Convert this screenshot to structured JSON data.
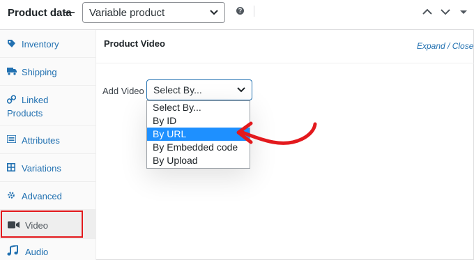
{
  "header": {
    "title": "Product data",
    "dash": "—",
    "product_type": "Variable product"
  },
  "sidebar": {
    "items": [
      {
        "label": "Inventory",
        "icon": "tag-icon"
      },
      {
        "label": "Shipping",
        "icon": "truck-icon"
      },
      {
        "label": "Linked",
        "label2": "Products",
        "icon": "link-icon"
      },
      {
        "label": "Attributes",
        "icon": "list-icon"
      },
      {
        "label": "Variations",
        "icon": "grid-icon"
      },
      {
        "label": "Advanced",
        "icon": "gear-icon"
      },
      {
        "label": "Video",
        "icon": "video-camera-icon"
      },
      {
        "label": "Audio",
        "icon": "music-icon"
      }
    ]
  },
  "panel": {
    "title": "Product Video",
    "expand_close": "Expand / Close",
    "add_video_label": "Add Video",
    "select_value": "Select By...",
    "options": [
      "Select By...",
      "By ID",
      "By URL",
      "By Embedded code",
      "By Upload"
    ],
    "selected_index": 2
  },
  "colors": {
    "link": "#2271b1",
    "selected_option": "#1e90ff",
    "annotation_red": "#e3191d"
  }
}
